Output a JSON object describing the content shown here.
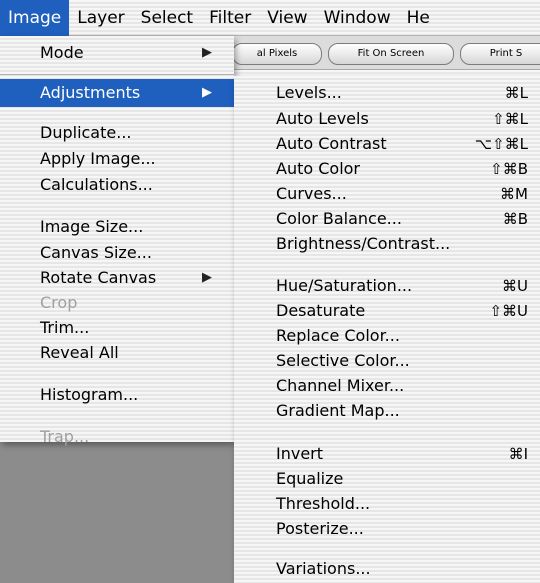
{
  "menubar": {
    "items": [
      "Image",
      "Layer",
      "Select",
      "Filter",
      "View",
      "Window",
      "He"
    ]
  },
  "options_bar": {
    "buttons": [
      "al Pixels",
      "Fit On Screen",
      "Print S"
    ]
  },
  "image_menu": {
    "mode": "Mode",
    "adjustments": "Adjustments",
    "duplicate": "Duplicate...",
    "apply_image": "Apply Image...",
    "calculations": "Calculations...",
    "image_size": "Image Size...",
    "canvas_size": "Canvas Size...",
    "rotate_canvas": "Rotate Canvas",
    "crop": "Crop",
    "trim": "Trim...",
    "reveal_all": "Reveal All",
    "histogram": "Histogram...",
    "trap": "Trap..."
  },
  "adjustments_menu": {
    "items": [
      {
        "label": "Levels...",
        "shortcut": "⌘L"
      },
      {
        "label": "Auto Levels",
        "shortcut": "⇧⌘L"
      },
      {
        "label": "Auto Contrast",
        "shortcut": "⌥⇧⌘L"
      },
      {
        "label": "Auto Color",
        "shortcut": "⇧⌘B"
      },
      {
        "label": "Curves...",
        "shortcut": "⌘M"
      },
      {
        "label": "Color Balance...",
        "shortcut": "⌘B"
      },
      {
        "label": "Brightness/Contrast...",
        "shortcut": ""
      },
      {
        "label": "Hue/Saturation...",
        "shortcut": "⌘U"
      },
      {
        "label": "Desaturate",
        "shortcut": "⇧⌘U"
      },
      {
        "label": "Replace Color...",
        "shortcut": ""
      },
      {
        "label": "Selective Color...",
        "shortcut": ""
      },
      {
        "label": "Channel Mixer...",
        "shortcut": ""
      },
      {
        "label": "Gradient Map...",
        "shortcut": ""
      },
      {
        "label": "Invert",
        "shortcut": "⌘I"
      },
      {
        "label": "Equalize",
        "shortcut": ""
      },
      {
        "label": "Threshold...",
        "shortcut": ""
      },
      {
        "label": "Posterize...",
        "shortcut": ""
      },
      {
        "label": "Variations...",
        "shortcut": ""
      }
    ]
  },
  "colors": {
    "highlight": "#1f5fbd",
    "disabled_text": "#a0a0a0"
  }
}
